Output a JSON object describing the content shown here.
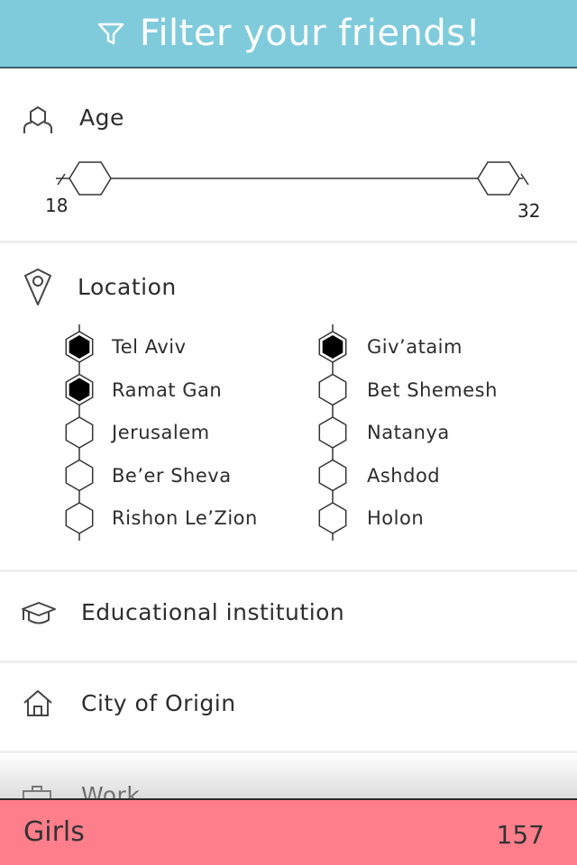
{
  "header": {
    "title": "Filter your friends!",
    "icon": "filter-icon"
  },
  "age": {
    "label": "Age",
    "icon": "person-icon",
    "min_label": "18",
    "max_label": "32",
    "range": {
      "min": 18,
      "max": 32
    }
  },
  "location": {
    "label": "Location",
    "icon": "map-pin-icon",
    "left_column": [
      {
        "name": "Tel Aviv",
        "selected": true
      },
      {
        "name": "Ramat Gan",
        "selected": true
      },
      {
        "name": "Jerusalem",
        "selected": false
      },
      {
        "name": "Be’er Sheva",
        "selected": false
      },
      {
        "name": "Rishon Le’Zion",
        "selected": false
      }
    ],
    "right_column": [
      {
        "name": "Giv’ataim",
        "selected": true
      },
      {
        "name": "Bet Shemesh",
        "selected": false
      },
      {
        "name": "Natanya",
        "selected": false
      },
      {
        "name": "Ashdod",
        "selected": false
      },
      {
        "name": "Holon",
        "selected": false
      }
    ]
  },
  "education": {
    "label": "Educational institution",
    "icon": "graduation-cap-icon"
  },
  "origin": {
    "label": "City of Origin",
    "icon": "house-icon"
  },
  "work": {
    "label": "Work",
    "icon": "briefcase-icon"
  },
  "footer": {
    "label": "Girls",
    "count": "157"
  },
  "colors": {
    "header_bg": "#7fcbdc",
    "footer_bg": "#ff7e8c"
  }
}
